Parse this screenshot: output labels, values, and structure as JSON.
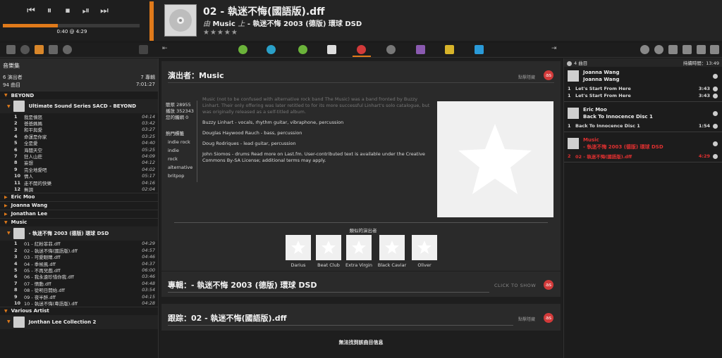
{
  "transport": {
    "elapsed_label": "0:40 @ 4:29",
    "progress_fraction": 0.4
  },
  "now_playing": {
    "title": "02 - 執迷不悔(國語版).dff",
    "by_prefix": "由",
    "artist": "Music",
    "on_prefix": "上",
    "album": "- 執迷不悔 2003 (德版) 環球 DSD",
    "rating_stars": "★★★★★"
  },
  "library": {
    "title": "音樂集",
    "artists_count": "6 演出者",
    "albums_count": "7 專輯",
    "tracks_count": "94 曲目",
    "total_time": "7:01:27",
    "groups": [
      {
        "artist": "BEYOND",
        "expanded": true,
        "album": "Ultimate Sound Series SACD - BEYOND",
        "tracks": [
          {
            "n": "1",
            "t": "我是憤怒",
            "d": "04:14"
          },
          {
            "n": "2",
            "t": "爸爸媽媽",
            "d": "03:42"
          },
          {
            "n": "3",
            "t": "和平與愛",
            "d": "03:27"
          },
          {
            "n": "4",
            "t": "命運是你家",
            "d": "03:25"
          },
          {
            "n": "5",
            "t": "全是愛",
            "d": "04:40"
          },
          {
            "n": "6",
            "t": "海闊天空",
            "d": "05:25"
          },
          {
            "n": "7",
            "t": "狂人山莊",
            "d": "04:09"
          },
          {
            "n": "8",
            "t": "妄想",
            "d": "04:12"
          },
          {
            "n": "9",
            "t": "完全地愛吧",
            "d": "04:02"
          },
          {
            "n": "10",
            "t": "情人",
            "d": "05:17"
          },
          {
            "n": "11",
            "t": "走不開的快樂",
            "d": "04:16"
          },
          {
            "n": "12",
            "t": "無調",
            "d": "02:04"
          }
        ]
      },
      {
        "artist": "Eric Moo",
        "expanded": false
      },
      {
        "artist": "Joanna Wang",
        "expanded": false
      },
      {
        "artist": "Jonathan Lee",
        "expanded": false
      },
      {
        "artist": "Music",
        "expanded": true,
        "album": "- 執迷不悔 2003 (德版) 環球 DSD",
        "tracks": [
          {
            "n": "1",
            "t": "01 - 紅粉菲菲.dff",
            "d": "04:29"
          },
          {
            "n": "2",
            "t": "02 - 執迷不悔(國語版).dff",
            "d": "04:57"
          },
          {
            "n": "3",
            "t": "03 - 可愛眼睛.dff",
            "d": "04:46"
          },
          {
            "n": "4",
            "t": "04 - 季候風.dff",
            "d": "04:37"
          },
          {
            "n": "5",
            "t": "05 - 不再兒戲.dff",
            "d": "06:00"
          },
          {
            "n": "6",
            "t": "06 - 我永遠珍惜你我.dff",
            "d": "03:46"
          },
          {
            "n": "7",
            "t": "07 - 情動.dff",
            "d": "04:48"
          },
          {
            "n": "8",
            "t": "08 - 從明日開始.dff",
            "d": "03:54"
          },
          {
            "n": "9",
            "t": "09 - 夜半醉.dff",
            "d": "04:15"
          },
          {
            "n": "10",
            "t": "10 - 執迷不悔(粵語版).dff",
            "d": "04:28"
          }
        ]
      },
      {
        "artist": "Various Artist",
        "expanded": true,
        "album": "Jonthan Lee Collection 2",
        "tracks": []
      }
    ]
  },
  "artist_card": {
    "title": "演出者：Music",
    "hide_label": "點擊隱藏",
    "lastfm_label": "as",
    "listeners": "聽眾 28955",
    "plays": "播放 352343",
    "your_plays": "您的觸網 0",
    "tags_heading": "熱門標籤",
    "tags": [
      "indie rock",
      "indie",
      "rock",
      "alternative",
      "britpop"
    ],
    "bio_muted": "Music (not to be confused with alternative rock band The Music) was a band fronted by Buzzy Linhart. Their only offering was later retitled to for its more successful Linhart's solo catalogue, but was originally released as a self-titled album.",
    "members": [
      "Buzzy Linhart - vocals, rhythm guitar, vibraphone, percussion",
      "Douglas Haywood Rauch - bass, percussion",
      "Doug Rodriques - lead guitar, percussion",
      "John Siomos - drums Read more on Last.fm. User-contributed text is available under the Creative Commons By-SA License; additional terms may apply."
    ],
    "similar_title": "類似的演出者",
    "similar": [
      "Darius",
      "Beat Club",
      "Extra Virgin",
      "Black Caviar",
      "Oliver"
    ]
  },
  "album_card": {
    "title": "專輯：- 執迷不悔 2003 (德版) 環球 DSD",
    "click_to_show": "CLICK TO SHOW"
  },
  "track_card": {
    "title": "跟踪：02 - 執迷不悔(國語版).dff",
    "hide_label": "點擊隱藏",
    "no_info": "無法找到該曲目信息"
  },
  "playlist": {
    "count_label": "4 曲目",
    "duration_label": "持續時間：13:49",
    "groups": [
      {
        "artist": "Joanna Wang",
        "album": "Joanna Wang",
        "tracks": [
          {
            "n": "1",
            "t": "Let's Start From Here",
            "d": "3:43"
          },
          {
            "n": "1",
            "t": "Let's Start From Here",
            "d": "3:43"
          }
        ]
      },
      {
        "artist": "Eric Moo",
        "album": "Back To Innocence Disc 1",
        "tracks": [
          {
            "n": "1",
            "t": "Back To Innocence Disc 1",
            "d": "1:54"
          }
        ]
      },
      {
        "artist": "Music",
        "album": "- 執迷不悔 2003 (德版) 環球 DSD",
        "active": true,
        "tracks": [
          {
            "n": "2",
            "t": "02 - 執迷不悔(國語版).dff",
            "d": "4:29"
          }
        ]
      }
    ]
  },
  "colors": {
    "accent": "#e07a1a",
    "lastfm": "#d23a3a",
    "active_track": "#e03030"
  }
}
